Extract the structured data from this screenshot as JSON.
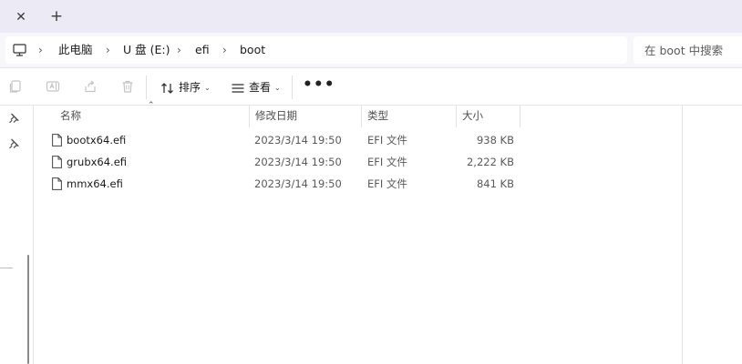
{
  "tabstrip": {
    "close_icon": "close-icon",
    "add_icon": "plus-icon"
  },
  "address": {
    "root_icon": "this-pc-icon",
    "crumbs": [
      "此电脑",
      "U 盘 (E:)",
      "efi",
      "boot"
    ]
  },
  "search": {
    "placeholder": "在 boot 中搜索"
  },
  "toolbar": {
    "sort_label": "排序",
    "view_label": "查看",
    "more_label": "•••",
    "icons": [
      "copy-icon",
      "rename-icon",
      "share-icon",
      "delete-icon",
      "sort-icon",
      "view-icon",
      "more-icon"
    ]
  },
  "columns": {
    "name": "名称",
    "date": "修改日期",
    "type": "类型",
    "size": "大小"
  },
  "files": [
    {
      "name": "bootx64.efi",
      "date": "2023/3/14 19:50",
      "type": "EFI 文件",
      "size": "938 KB"
    },
    {
      "name": "grubx64.efi",
      "date": "2023/3/14 19:50",
      "type": "EFI 文件",
      "size": "2,222 KB"
    },
    {
      "name": "mmx64.efi",
      "date": "2023/3/14 19:50",
      "type": "EFI 文件",
      "size": "841 KB"
    }
  ],
  "colors": {
    "tabstrip_bg": "#ecebf5",
    "address_bg": "#f7f6fb",
    "text": "#1b1b1b",
    "muted_text": "#5a5a5a"
  }
}
